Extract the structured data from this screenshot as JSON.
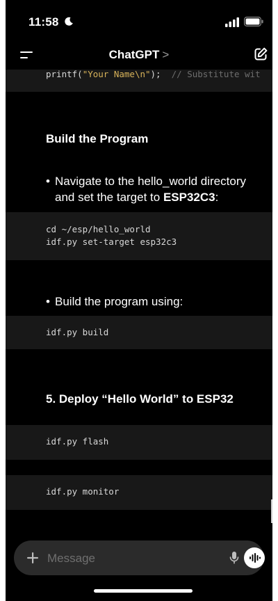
{
  "status_bar": {
    "time": "11:58",
    "icons": [
      "moon-icon",
      "cellular-signal-icon",
      "battery-icon"
    ]
  },
  "header": {
    "title": "ChatGPT",
    "chevron": ">",
    "icons": [
      "menu-icon",
      "new-chat-icon"
    ]
  },
  "conversation": {
    "code_top": {
      "func": "printf(",
      "string": "\"Your Name\\n\"",
      "end": ");",
      "comment": "// Substitute wit"
    },
    "heading_build": "Build the Program",
    "bullet_navigate": {
      "dot": "•",
      "text_before": "Navigate to the hello_world directory and set the target to ",
      "bold": "ESP32C3",
      "text_after": ":"
    },
    "code_target": {
      "line1": "cd ~/esp/hello_world",
      "line2": "idf.py set-target esp32c3"
    },
    "bullet_build": {
      "dot": "•",
      "text": "Build the program using:"
    },
    "code_build": "idf.py build",
    "heading_deploy": "5. Deploy “Hello World” to ESP32",
    "code_flash": "idf.py flash",
    "code_monitor": "idf.py monitor"
  },
  "composer": {
    "placeholder": "Message",
    "icons": [
      "plus-icon",
      "microphone-icon",
      "voice-mode-icon"
    ]
  },
  "colors": {
    "background": "#000000",
    "code_background": "#181818",
    "string": "#d8b35a",
    "comment": "#6d6d6d",
    "composer_background": "#2b2b2b"
  }
}
